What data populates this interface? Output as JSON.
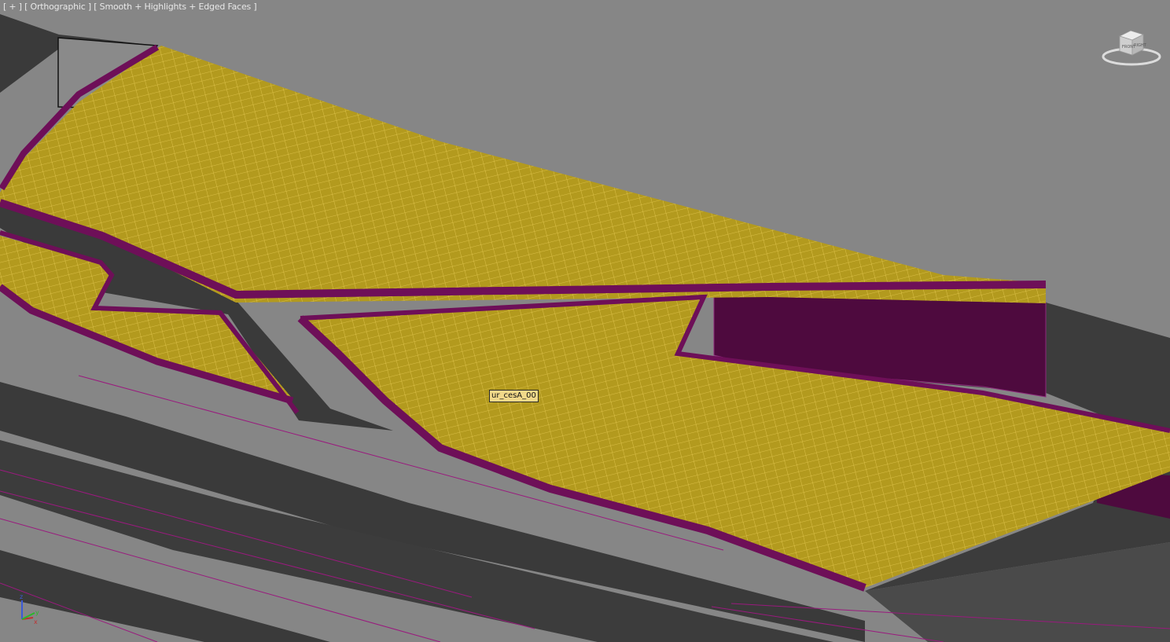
{
  "viewport": {
    "label": {
      "menu": "[ + ]",
      "view": "[ Orthographic ]",
      "shading": "[ Smooth + Highlights + Edged Faces ]"
    },
    "object_tag": "ur_cesA_00",
    "viewcube": {
      "top": "TOP",
      "front": "FRONT",
      "right": "RIGHT",
      "icon": "viewcube-icon"
    },
    "axis": {
      "z": "z",
      "x": "x",
      "y": "y",
      "icon": "axis-tripod-icon"
    }
  },
  "colors": {
    "background": "#868686",
    "mesh_surface": "#b39a1e",
    "mesh_wire": "#e2c64a",
    "curb": "#6e0f58",
    "curb_dark": "#4c0a3c",
    "road": "#3c3c3c",
    "line": "#9a1a7e",
    "axis_x": "#c03030",
    "axis_y": "#28b828",
    "axis_z": "#3a5ad8"
  }
}
